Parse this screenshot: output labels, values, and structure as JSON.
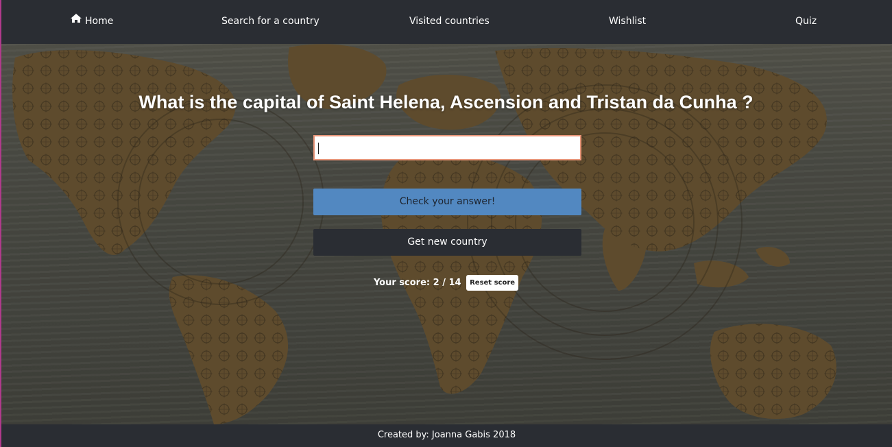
{
  "nav": {
    "home": "Home",
    "search": "Search for a country",
    "visited": "Visited countries",
    "wishlist": "Wishlist",
    "quiz": "Quiz",
    "home_icon": "home-icon"
  },
  "quiz": {
    "question": "What is the capital of Saint Helena, Ascension and Tristan da Cunha ?",
    "answer_value": "",
    "check_label": "Check your answer!",
    "new_country_label": "Get new country",
    "score_label": "Your score:",
    "score_value": "2 / 14",
    "reset_label": "Reset score"
  },
  "footer": {
    "credit": "Created by: Joanna Gabis 2018"
  },
  "colors": {
    "navbar": "#2a2d33",
    "check_button": "#5288c1",
    "new_button": "#2a2d33",
    "input_border": "#e9967a",
    "map_land": "#6b5430"
  }
}
